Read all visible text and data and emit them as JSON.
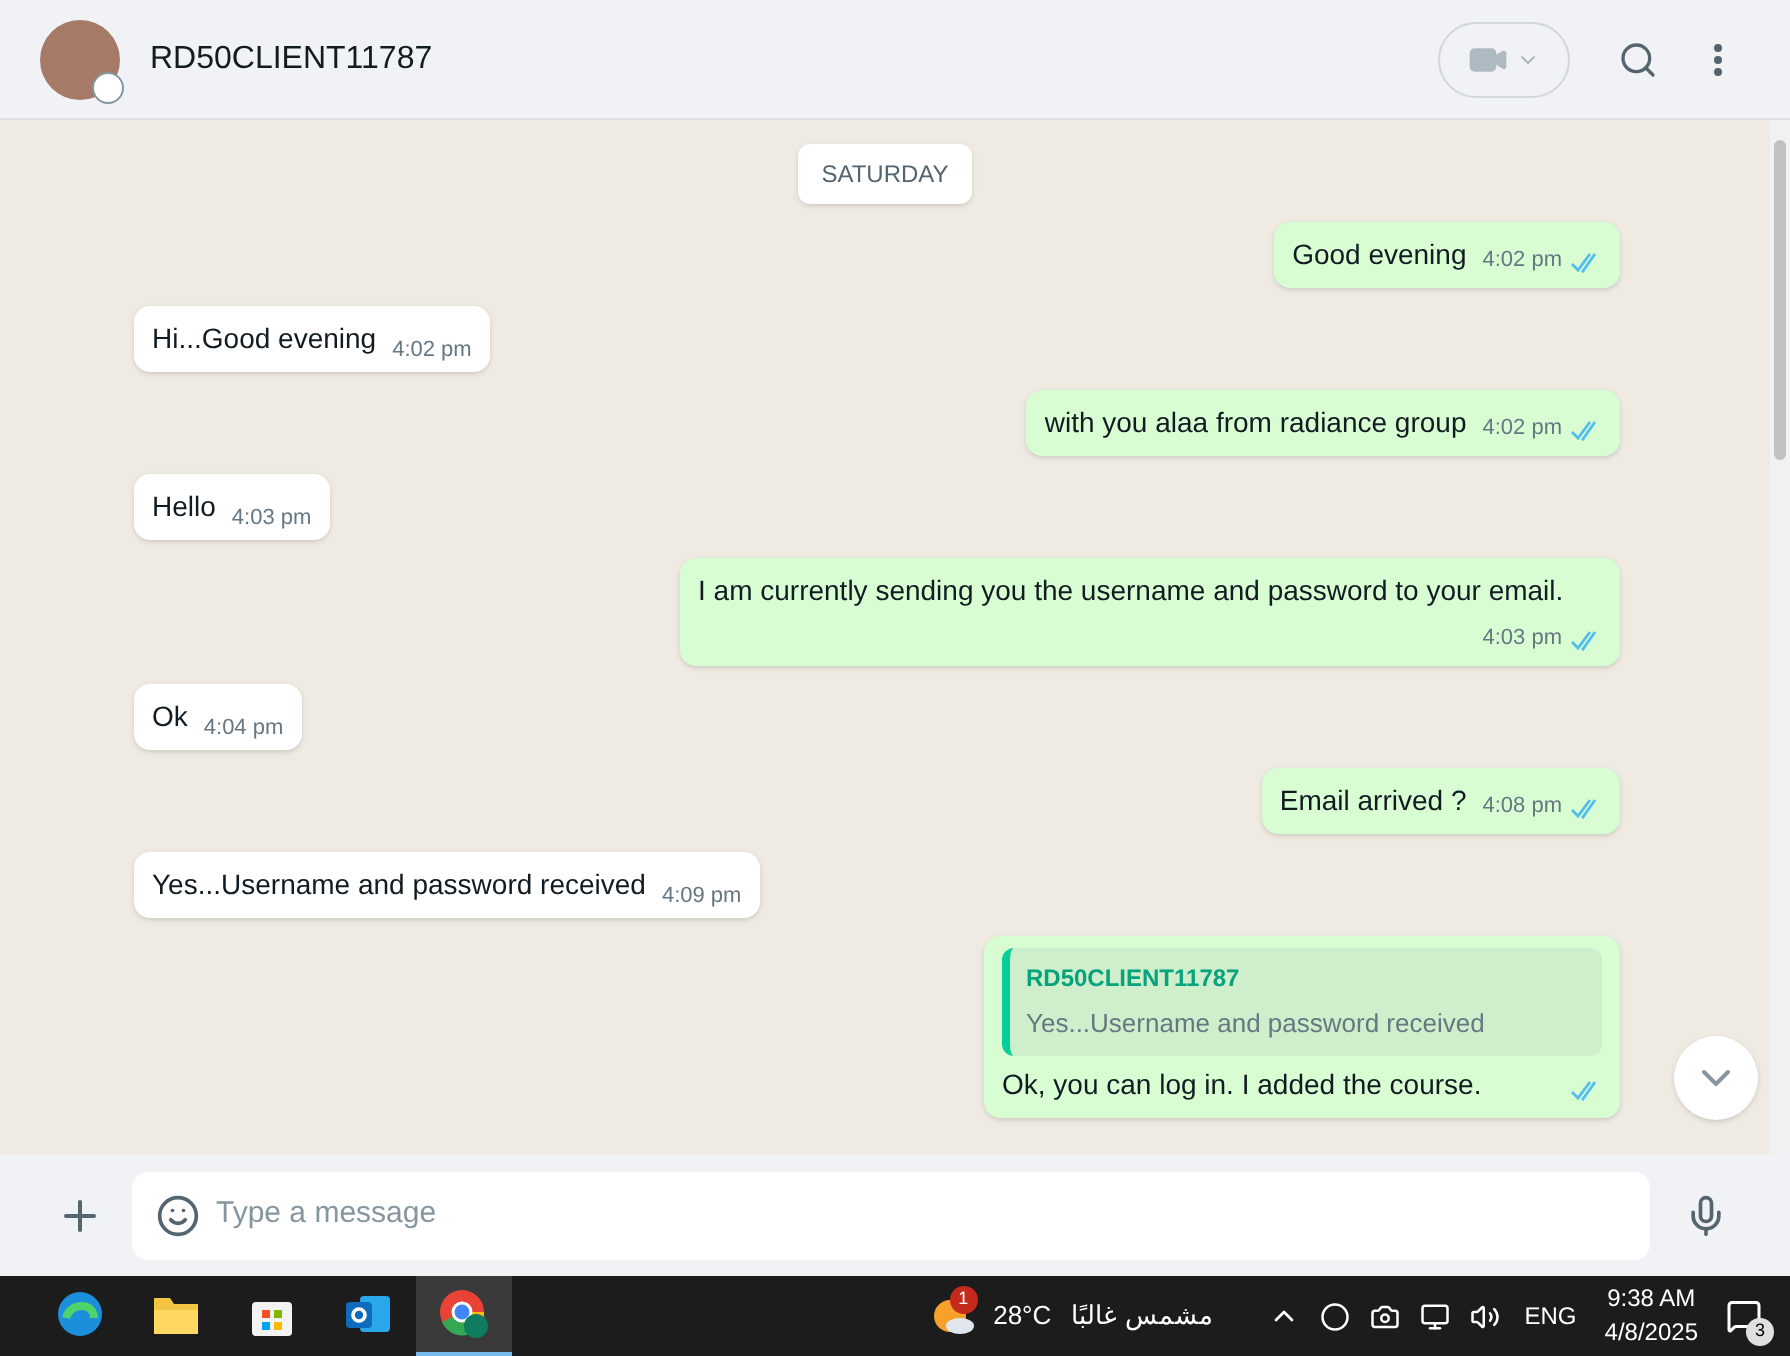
{
  "header": {
    "contact_name": "RD50CLIENT11787"
  },
  "messages": [
    {
      "kind": "date",
      "text": "SATURDAY"
    },
    {
      "kind": "out",
      "text": "Good evening",
      "time": "4:02 pm",
      "read": true
    },
    {
      "kind": "in",
      "text": "Hi...Good evening",
      "time": "4:02 pm"
    },
    {
      "kind": "out",
      "text": "with you alaa from radiance group",
      "time": "4:02 pm",
      "read": true
    },
    {
      "kind": "in",
      "text": "Hello",
      "time": "4:03 pm"
    },
    {
      "kind": "out",
      "text": "I am currently sending you the username and password to your email.",
      "time": "4:03 pm",
      "read": true
    },
    {
      "kind": "in",
      "text": "Ok",
      "time": "4:04 pm"
    },
    {
      "kind": "out",
      "text": "Email arrived ?",
      "time": "4:08 pm",
      "read": true
    },
    {
      "kind": "in",
      "text": "Yes...Username and password received",
      "time": "4:09 pm"
    },
    {
      "kind": "out",
      "text": "Ok, you can log in. I added the course.",
      "read": true,
      "reply": {
        "author": "RD50CLIENT11787",
        "text": "Yes...Username and password received"
      }
    }
  ],
  "composer": {
    "placeholder": "Type a message"
  },
  "taskbar": {
    "apps": [
      {
        "kind": "edge",
        "selected": false
      },
      {
        "kind": "folder",
        "selected": false
      },
      {
        "kind": "store",
        "selected": false
      },
      {
        "kind": "outlook",
        "selected": false
      },
      {
        "kind": "chrome",
        "selected": true
      }
    ],
    "weather": {
      "badge": "1",
      "temperature": "28°C",
      "condition": "مشمس غالبًا"
    },
    "language": "ENG",
    "time": "9:38 AM",
    "date": "4/8/2025",
    "notifications": "3"
  }
}
